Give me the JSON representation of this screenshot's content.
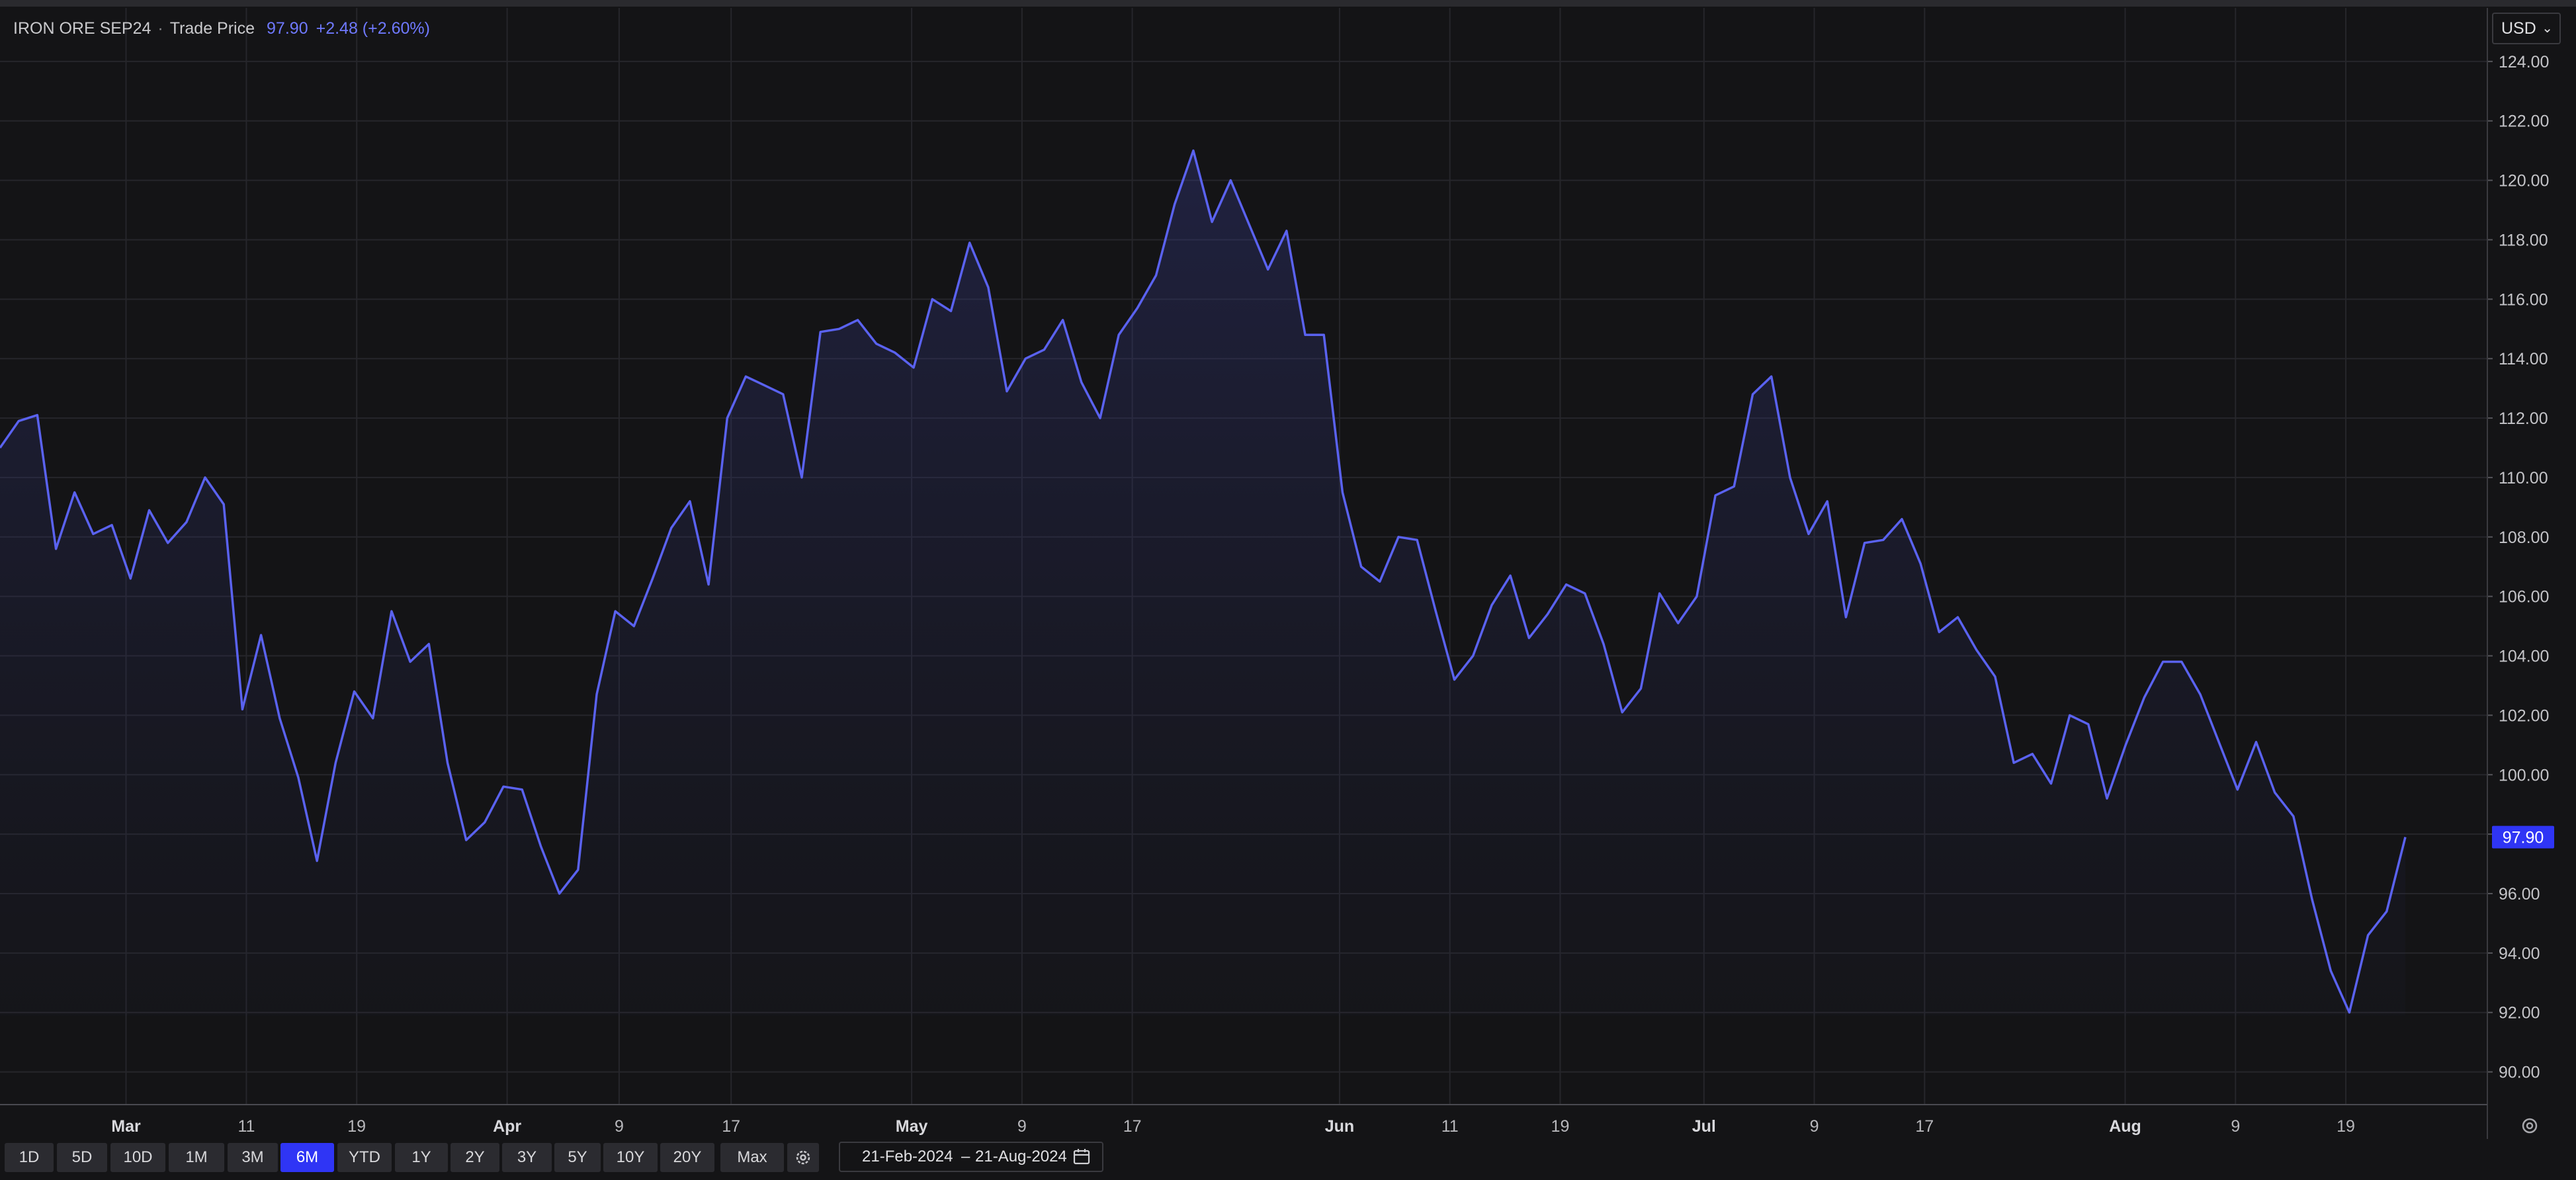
{
  "legend": {
    "symbol": "IRON ORE SEP24",
    "separator": "·",
    "series_label": "Trade Price",
    "last_value": "97.90",
    "change": "+2.48 (+2.60%)"
  },
  "currency": {
    "selected": "USD"
  },
  "toolbar": {
    "ranges": [
      "1D",
      "5D",
      "10D",
      "1M",
      "3M",
      "6M",
      "YTD",
      "1Y",
      "2Y",
      "3Y",
      "5Y",
      "10Y",
      "20Y",
      "Max"
    ],
    "active_range": "6M",
    "date_start": "21-Feb-2024",
    "date_sep": "–",
    "date_end": "21-Aug-2024"
  },
  "icons": {
    "settings": "gear-icon",
    "calendar": "calendar-icon",
    "chevron": "chevron-down-icon"
  },
  "colors": {
    "line": "#5a62f0",
    "accent": "#2f35f5",
    "background": "#141416",
    "grid": "#26262b"
  },
  "chart_data": {
    "type": "area",
    "ylim": [
      88.9,
      125.8
    ],
    "y_ticks": [
      "90.00",
      "92.00",
      "94.00",
      "96.00",
      "98.00",
      "100.00",
      "102.00",
      "104.00",
      "106.00",
      "108.00",
      "110.00",
      "112.00",
      "114.00",
      "116.00",
      "118.00",
      "120.00",
      "122.00",
      "124.00"
    ],
    "x_tick_labels": [
      "Mar",
      "11",
      "19",
      "Apr",
      "9",
      "17",
      "May",
      "9",
      "17",
      "Jun",
      "11",
      "19",
      "Jul",
      "9",
      "17",
      "Aug",
      "9",
      "19"
    ],
    "x_tick_major": [
      true,
      false,
      false,
      true,
      false,
      false,
      true,
      false,
      false,
      true,
      false,
      false,
      true,
      false,
      false,
      true,
      false,
      false
    ],
    "last_value_label": "97.90",
    "grid": true,
    "series": [
      {
        "values": [
          111.0,
          111.9,
          112.1,
          107.6,
          109.5,
          108.1,
          108.4,
          106.6,
          108.9,
          107.8,
          108.5,
          110.0,
          109.1,
          102.2,
          104.7,
          101.9,
          99.9,
          97.1,
          100.4,
          102.8,
          101.9,
          105.5,
          103.8,
          104.4,
          100.4,
          97.8,
          98.4,
          99.6,
          99.5,
          97.6,
          96.0,
          96.8,
          102.7,
          105.5,
          105.0,
          106.6,
          108.3,
          109.2,
          106.4,
          112.0,
          113.4,
          113.1,
          112.8,
          110.0,
          114.9,
          115.0,
          115.3,
          114.5,
          114.2,
          113.7,
          116.0,
          115.6,
          117.9,
          116.4,
          112.9,
          114.0,
          114.3,
          115.3,
          113.2,
          112.0,
          114.8,
          115.7,
          116.8,
          119.2,
          121.0,
          118.6,
          120.0,
          118.5,
          117.0,
          118.3,
          114.8,
          114.8,
          109.5,
          107.0,
          106.5,
          108.0,
          107.9,
          105.5,
          103.2,
          104.0,
          105.7,
          106.7,
          104.6,
          105.4,
          106.4,
          106.1,
          104.4,
          102.1,
          102.9,
          106.1,
          105.1,
          106.0,
          109.4,
          109.7,
          112.8,
          113.4,
          110.0,
          108.1,
          109.2,
          105.3,
          107.8,
          107.9,
          108.6,
          107.1,
          104.8,
          105.3,
          104.2,
          103.3,
          100.4,
          100.7,
          99.7,
          102.0,
          101.7,
          99.2,
          101.0,
          102.6,
          103.8,
          103.8,
          102.7,
          101.1,
          99.5,
          101.1,
          99.4,
          98.6,
          95.8,
          93.4,
          92.0,
          94.6,
          95.4,
          97.9
        ]
      }
    ]
  }
}
